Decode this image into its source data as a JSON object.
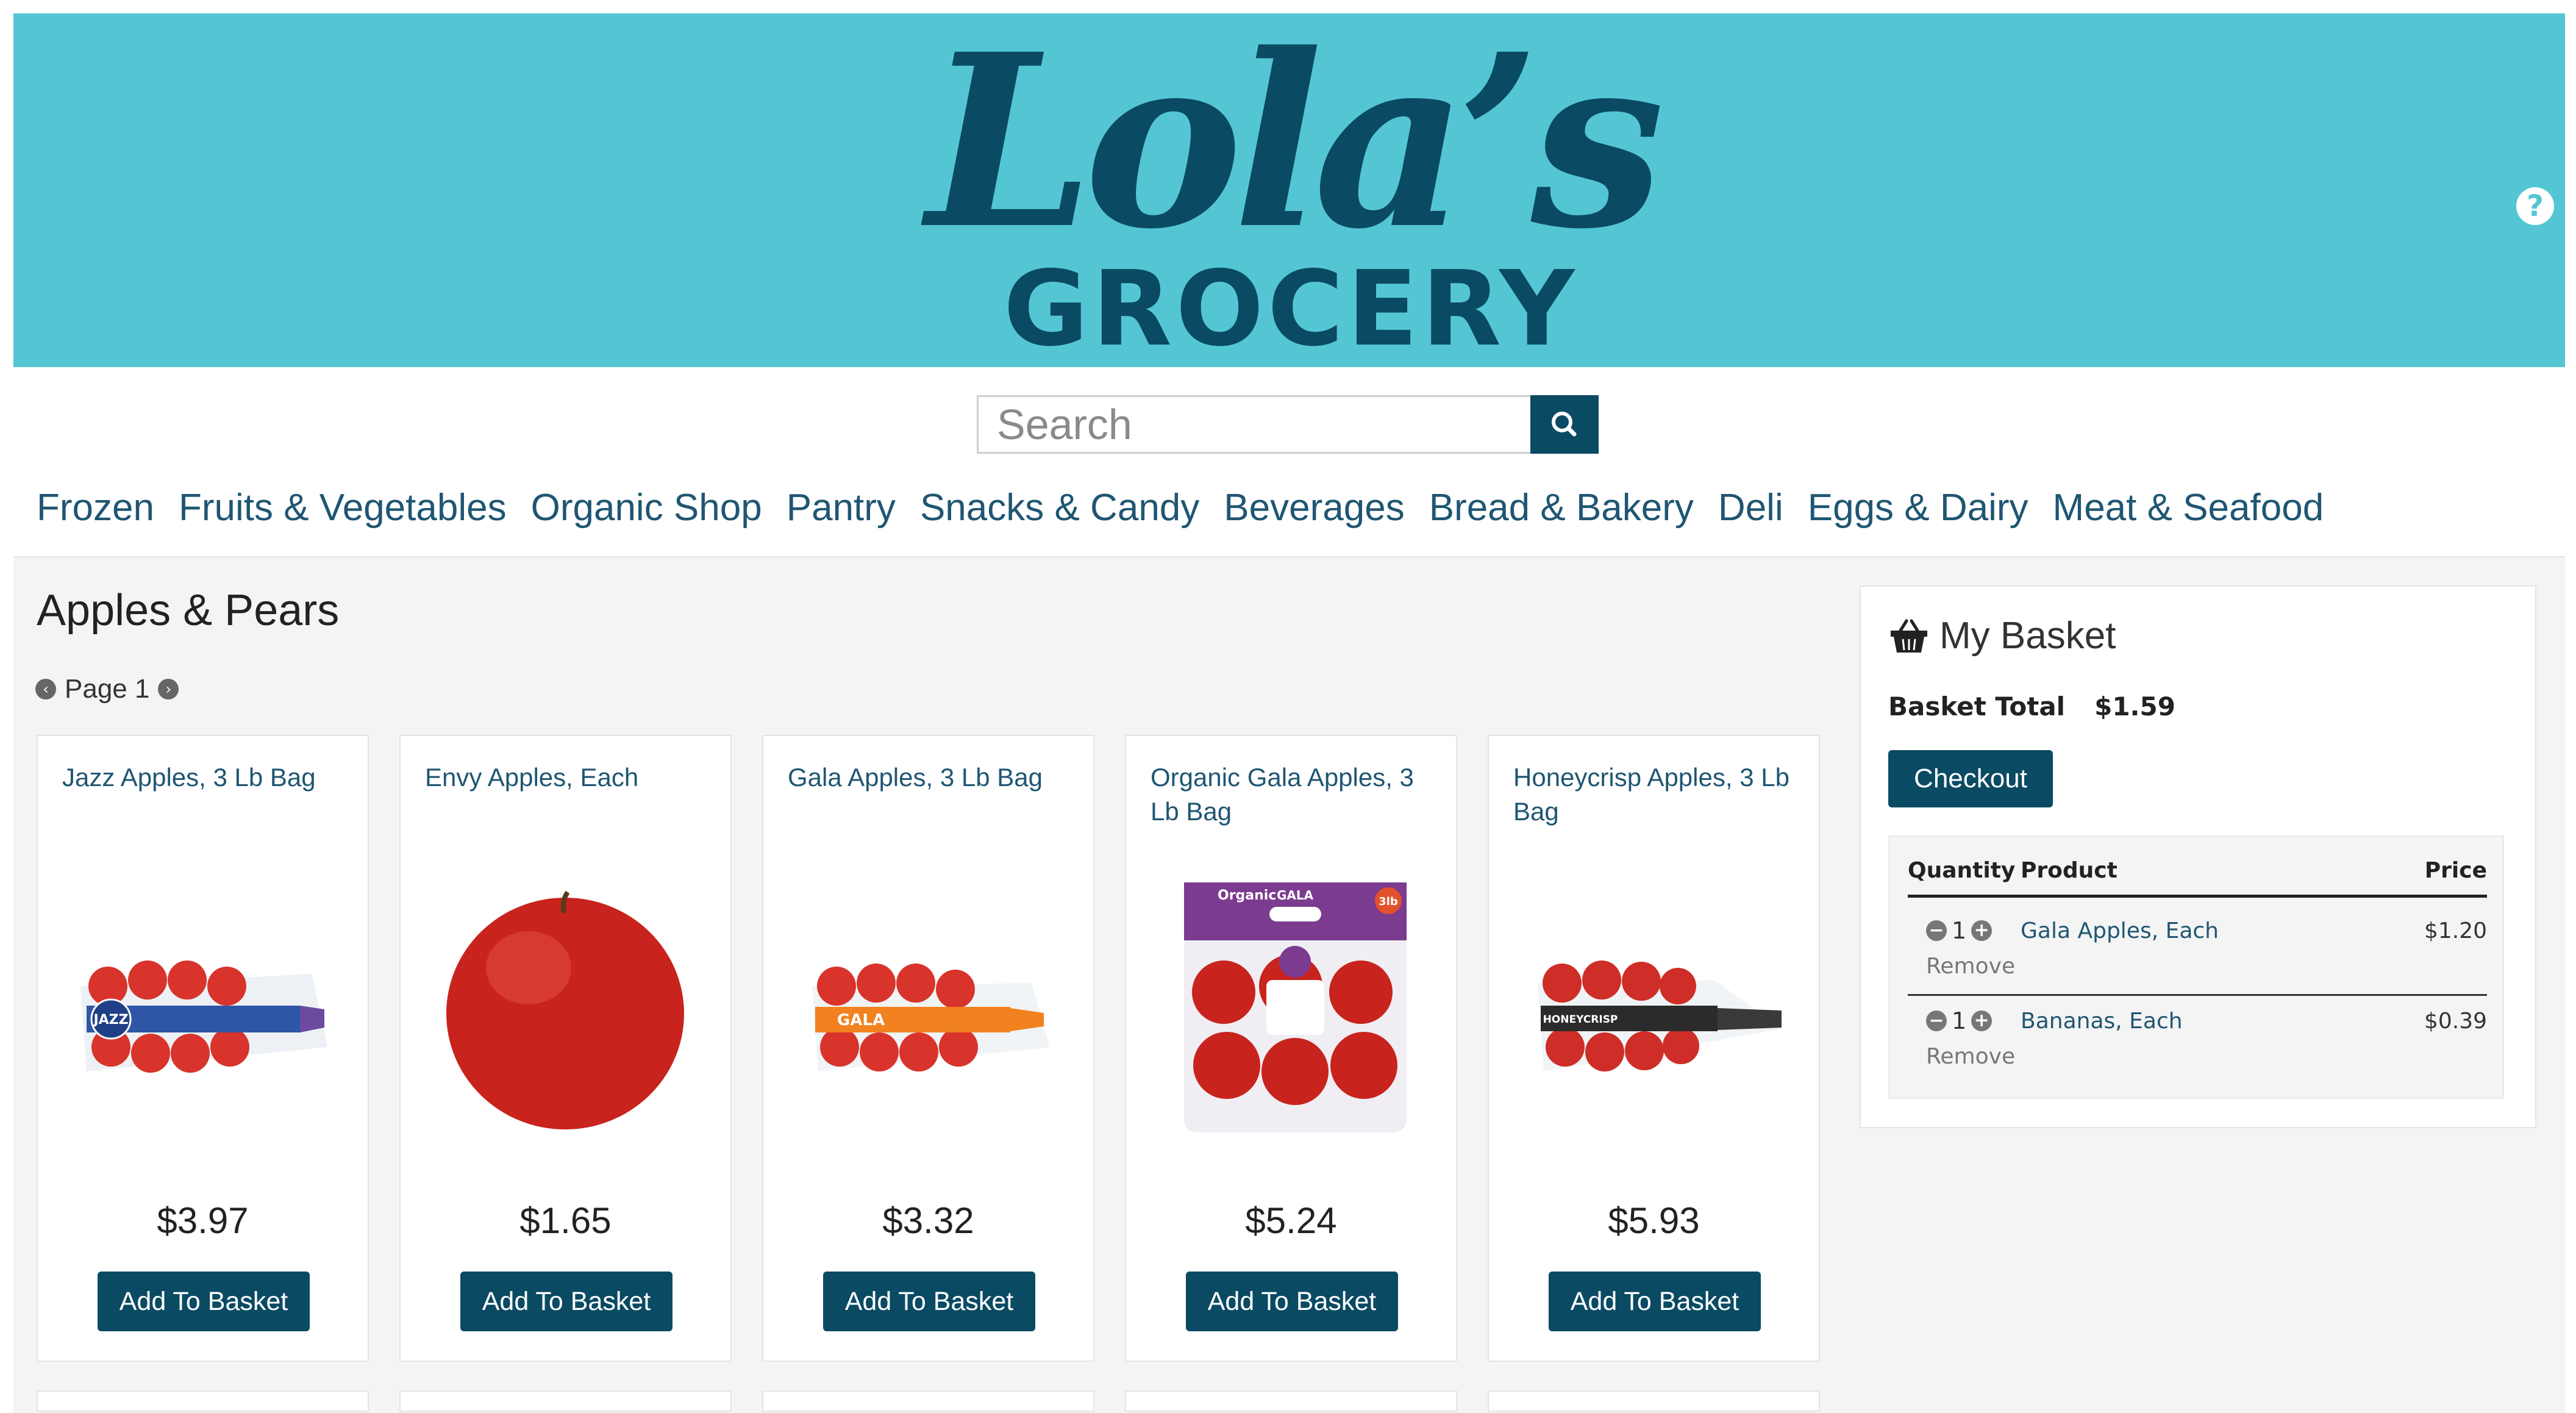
{
  "brand": {
    "script": "Lola’s",
    "word": "GROCERY",
    "color": "#0a4a63",
    "header_bg": "#54c6d3"
  },
  "header": {
    "help_icon": "question-circle-icon"
  },
  "search": {
    "placeholder": "Search",
    "icon": "search-icon"
  },
  "nav": {
    "items": [
      {
        "label": "Frozen"
      },
      {
        "label": "Fruits & Vegetables"
      },
      {
        "label": "Organic Shop"
      },
      {
        "label": "Pantry"
      },
      {
        "label": "Snacks & Candy"
      },
      {
        "label": "Beverages"
      },
      {
        "label": "Bread & Bakery"
      },
      {
        "label": "Deli"
      },
      {
        "label": "Eggs & Dairy"
      },
      {
        "label": "Meat & Seafood"
      }
    ]
  },
  "category": {
    "title": "Apples & Pears",
    "page_label": "Page 1"
  },
  "products": [
    {
      "name": "Jazz Apples, 3 Lb Bag",
      "price": "$3.97",
      "button": "Add To Basket",
      "image": "jazz-apples-bag-image",
      "bag_label": "JAZZ"
    },
    {
      "name": "Envy Apples, Each",
      "price": "$1.65",
      "button": "Add To Basket",
      "image": "envy-apple-image"
    },
    {
      "name": "Gala Apples, 3 Lb Bag",
      "price": "$3.32",
      "button": "Add To Basket",
      "image": "gala-apples-bag-image",
      "bag_label": "GALA"
    },
    {
      "name": "Organic Gala Apples, 3 Lb Bag",
      "price": "$5.24",
      "button": "Add To Basket",
      "image": "organic-gala-apples-bag-image",
      "bag_label": "GALA",
      "bag_brand": "Organic",
      "bag_weight": "3lb"
    },
    {
      "name": "Honeycrisp Apples, 3 Lb Bag",
      "price": "$5.93",
      "button": "Add To Basket",
      "image": "honeycrisp-apples-bag-image",
      "bag_label": "HONEYCRISP"
    }
  ],
  "basket": {
    "title": "My Basket",
    "icon": "basket-icon",
    "total_label": "Basket Total",
    "total_value": "$1.59",
    "checkout": "Checkout",
    "headers": {
      "quantity": "Quantity",
      "product": "Product",
      "price": "Price"
    },
    "items": [
      {
        "qty": "1",
        "product": "Gala Apples, Each",
        "price": "$1.20",
        "remove": "Remove"
      },
      {
        "qty": "1",
        "product": "Bananas, Each",
        "price": "$0.39",
        "remove": "Remove"
      }
    ]
  }
}
